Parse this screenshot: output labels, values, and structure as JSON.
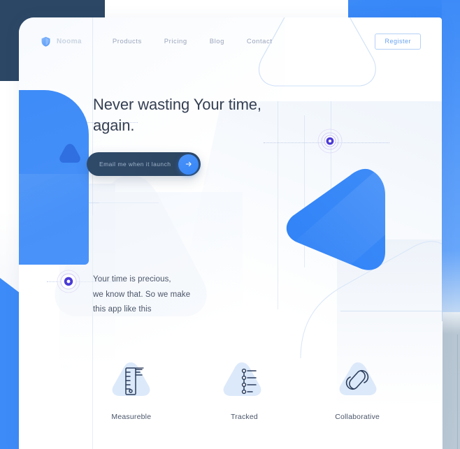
{
  "nav": {
    "brand_name": "Nooma",
    "brand_icon": "shield-logo-icon",
    "links": [
      {
        "label": "Products"
      },
      {
        "label": "Pricing"
      },
      {
        "label": "Blog"
      },
      {
        "label": "Contact"
      }
    ],
    "register_label": "Register"
  },
  "hero": {
    "title": "Never wasting Your time,\nagain.",
    "signup": {
      "placeholder": "Email me when it launch",
      "value": "",
      "submit_icon": "arrow-right-icon"
    }
  },
  "precious": {
    "text": "Your time is precious,\nwe know that. So we make\nthis app like this",
    "marker_icon": "target-ring-icon"
  },
  "features": [
    {
      "label": "Measureble",
      "icon": "ruler-icon"
    },
    {
      "label": "Tracked",
      "icon": "checklist-icon"
    },
    {
      "label": "Collaborative",
      "icon": "link-chain-icon"
    }
  ],
  "decor": {
    "top_marker_icon": "target-ring-icon"
  },
  "colors": {
    "primary_blue": "#3d8bf8",
    "navy": "#2c4765",
    "dark_pill": "#2f4a69",
    "purple_marker": "#4b3bd6",
    "text_dark": "#343f52",
    "text_body": "#4a5568",
    "nav_link": "#9aa5bb",
    "register_border": "#b5d1f7",
    "icon_navy": "#2d3e5c",
    "blob_blue": "#dce9fa"
  }
}
